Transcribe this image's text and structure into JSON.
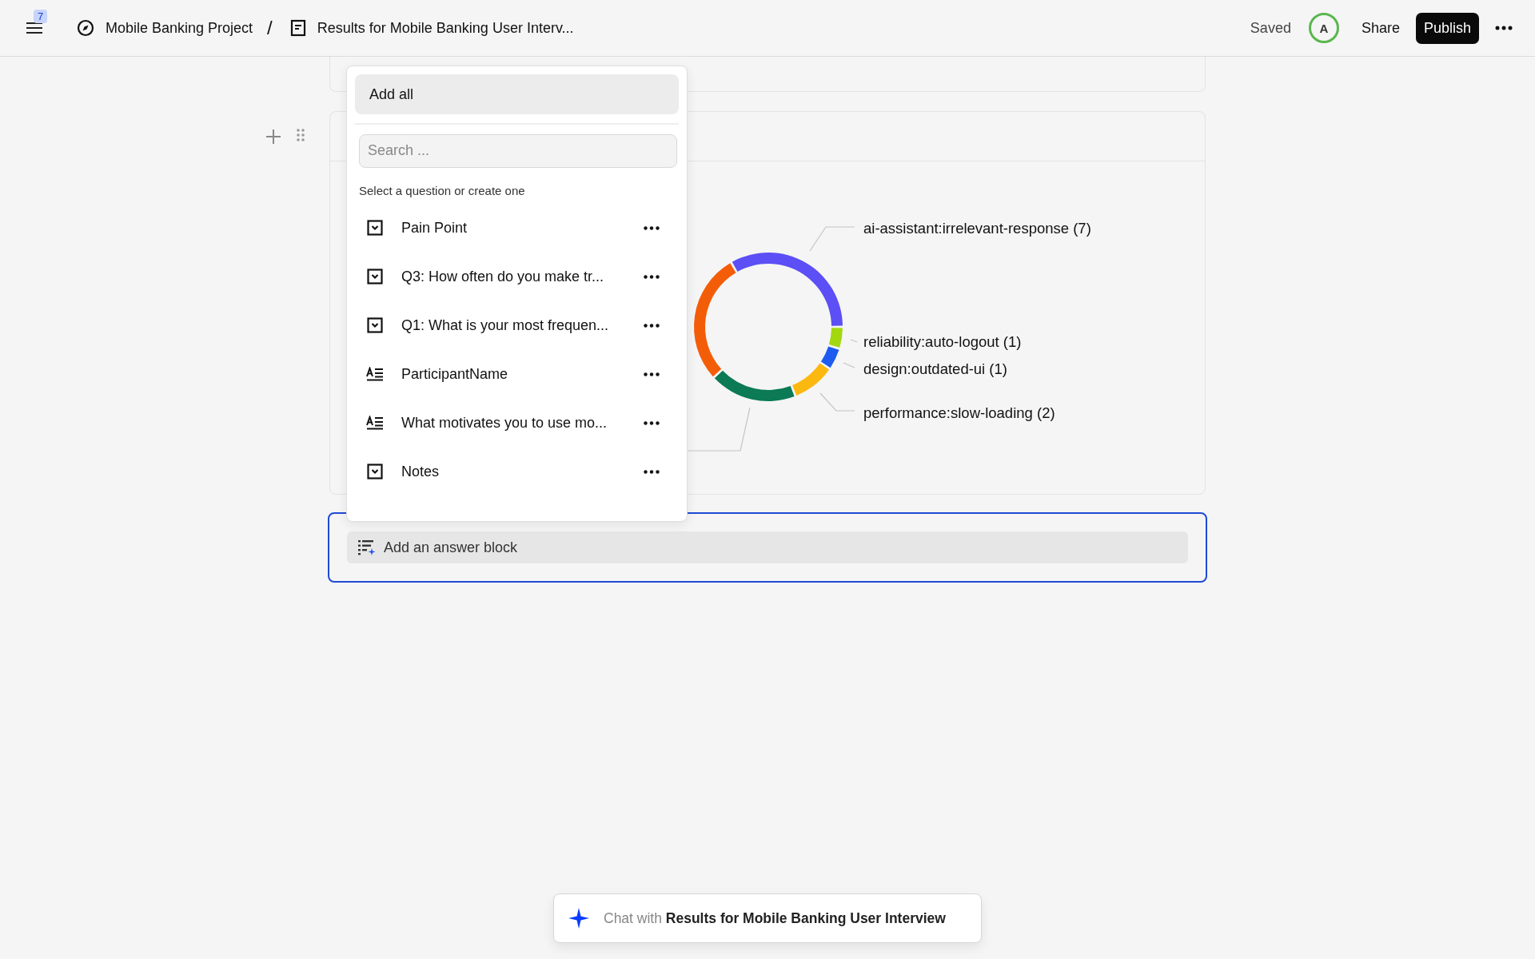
{
  "topbar": {
    "notification_count": "7",
    "breadcrumbs": [
      {
        "kind": "project",
        "label": "Mobile Banking Project"
      },
      {
        "kind": "document",
        "label": "Results for Mobile Banking User Interv..."
      }
    ],
    "separator": "/",
    "status": "Saved",
    "avatar": "A",
    "share": "Share",
    "publish": "Publish"
  },
  "dropdown": {
    "add_all": "Add all",
    "search": {
      "placeholder": "Search ..."
    },
    "hint": "Select a question or create one",
    "items": [
      {
        "kind": "choice",
        "label": "Pain Point"
      },
      {
        "kind": "choice",
        "label": "Q3: How often do you make tr..."
      },
      {
        "kind": "choice",
        "label": "Q1: What is your most frequen..."
      },
      {
        "kind": "text",
        "label": "ParticipantName"
      },
      {
        "kind": "text",
        "label": "What motivates you to use mo..."
      },
      {
        "kind": "choice",
        "label": "Notes"
      }
    ]
  },
  "chart": {
    "chart_data": {
      "type": "donut",
      "categories": [
        "ai-assistant:irrelevant-response (7)",
        "reliability:auto-logout (1)",
        "design:outdated-ui (1)",
        "performance:slow-loading (2)",
        null,
        null
      ],
      "values": [
        7,
        1,
        1,
        2,
        4,
        6
      ],
      "colors": [
        "#5b4ff5",
        "#a3d80f",
        "#1e5cf0",
        "#fbb80f",
        "#0b7a55",
        "#f45d07"
      ]
    }
  },
  "answer_block": {
    "label": "Add an answer block",
    "focused": true
  },
  "chat": {
    "text": "Chat with **Results for Mobile Banking User Interview**"
  }
}
